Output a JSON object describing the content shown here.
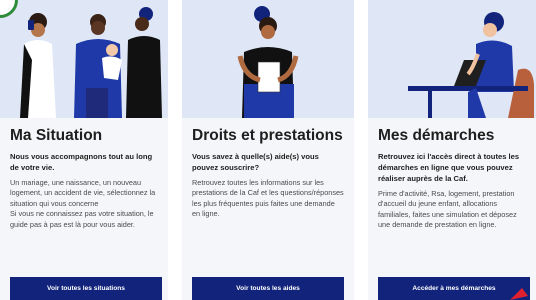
{
  "colors": {
    "illustration_bg": "#dfe7f7",
    "card_bg": "#f4f6f9",
    "button_bg": "#12237b",
    "accent_red": "#e0202e",
    "logo_green": "#2e8b3a"
  },
  "cards": [
    {
      "title": "Ma Situation",
      "lead": "Nous vous accompagnons tout au long de votre vie.",
      "desc1": "Un mariage, une naissance, un nouveau logement, un accident de vie, sélectionnez la situation qui vous concerne",
      "desc2": "Si vous ne connaissez pas votre situation, le guide pas à pas est là pour vous aider.",
      "button": "Voir toutes les situations",
      "illustration_icon": "family-illustration"
    },
    {
      "title": "Droits et prestations",
      "lead": "Vous savez à quelle(s) aide(s) vous pouvez souscrire?",
      "desc1": "Retrouvez toutes les informations sur les prestations de la Caf et les questions/réponses les plus fréquentes puis faites une demande en ligne.",
      "button": "Voir toutes les aides",
      "illustration_icon": "woman-with-document-illustration"
    },
    {
      "title": "Mes démarches",
      "lead": "Retrouvez ici l'accès direct à toutes les démarches en ligne que vous pouvez réaliser auprès de la Caf.",
      "desc1": "Prime d'activité, Rsa, logement, prestation d'accueil du jeune enfant, allocations familiales, faites une simulation et déposez une demande de prestation en ligne.",
      "button": "Accéder à mes démarches",
      "illustration_icon": "man-at-laptop-illustration"
    }
  ]
}
